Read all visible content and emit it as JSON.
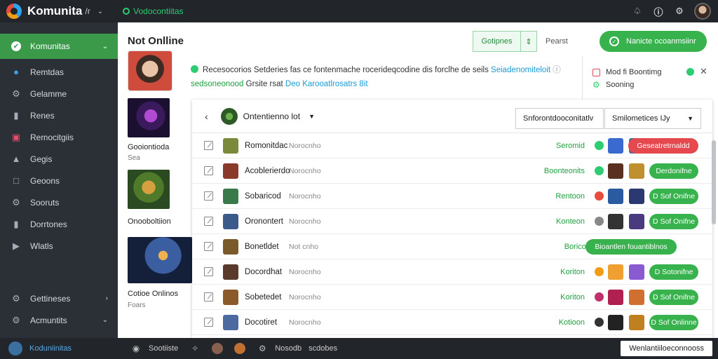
{
  "topbar": {
    "app_name": "Komunita",
    "app_sub": "/r",
    "status": "Vodocontiitas"
  },
  "sidebar": {
    "items": [
      {
        "label": "Komunitas",
        "icon": "check-icon"
      },
      {
        "label": "Remtdas",
        "icon": "people-icon"
      },
      {
        "label": "Gelamme",
        "icon": "gear-icon"
      },
      {
        "label": "Renes",
        "icon": "bookmark-icon"
      },
      {
        "label": "Remocitgiis",
        "icon": "chart-icon"
      },
      {
        "label": "Gegis",
        "icon": "lock-icon"
      },
      {
        "label": "Geoons",
        "icon": "document-icon"
      },
      {
        "label": "Sooruts",
        "icon": "gear-icon"
      },
      {
        "label": "Dorrtones",
        "icon": "briefcase-icon"
      },
      {
        "label": "Wlatls",
        "icon": "play-icon"
      }
    ],
    "bottom_items": [
      {
        "label": "Gettineses",
        "icon": "gear-icon"
      },
      {
        "label": "Acmuntits",
        "icon": "gear-icon"
      }
    ]
  },
  "main": {
    "page_title": "Not Onlline",
    "btn_secondary": "Gotipnes",
    "report_label": "Pearst",
    "btn_primary": "Nanicte ocoanmsiinr",
    "notice": {
      "line1_a": "Recesocorios Setderies fas ce fontenmache rocerideqcodine dis forclhe de seils",
      "line1_link": "Seiadenomiteloit",
      "line2_green": "sedsoneonood",
      "line2_b": "Grsite rsat",
      "line2_link": "Deo Karooatlrosatrs 8it"
    },
    "right_panel": {
      "row1": "Mod fi Boontimg",
      "row2": "Sooning"
    },
    "profile_thumbs": [
      {
        "caption": "Gooiontioda",
        "sub": "Sea"
      },
      {
        "caption": "Onooboltiion",
        "sub": ""
      },
      {
        "caption": "Cotioe Onlinos",
        "sub": "Foars"
      }
    ]
  },
  "table": {
    "title": "Ontentienno lot",
    "filter1": "Snforontdooconitatlv",
    "filter2": "Smilometices IJy",
    "rows": [
      {
        "name": "Romonitdac",
        "sub": "Norocnho",
        "status": "Seromid",
        "action": "Geseatretrnaldd",
        "action_type": "red"
      },
      {
        "name": "Acoblerierdo",
        "sub": "Norocnho",
        "status": "Boonteonits",
        "action": "Derdonifne",
        "action_type": "green"
      },
      {
        "name": "Sobaricod",
        "sub": "Norocnho",
        "status": "Rentoon",
        "action": "D Sof Onifne",
        "action_type": "green"
      },
      {
        "name": "Oronontert",
        "sub": "Norocnho",
        "status": "Konteon",
        "action": "D Sof Onifne",
        "action_type": "green"
      },
      {
        "name": "Bonetldet",
        "sub": "Not cnho",
        "status": "Boricon",
        "action": "Bioantlen fouantiblnos",
        "action_type": "wide"
      },
      {
        "name": "Docordhat",
        "sub": "Norocnho",
        "status": "Koriton",
        "action": "D Sotonifne",
        "action_type": "green"
      },
      {
        "name": "Sobetedet",
        "sub": "Norocnho",
        "status": "Koriton",
        "action": "D Sof Onifne",
        "action_type": "green"
      },
      {
        "name": "Docotiret",
        "sub": "Norocnho",
        "status": "Kotioon",
        "action": "D Sof Onlinne",
        "action_type": "green"
      }
    ]
  },
  "bottombar": {
    "left_label": "Koduniinitas",
    "items": [
      "Sootiiste",
      "Nosodb",
      "scdobes"
    ],
    "status": "Wenlantiiloeconnooss"
  },
  "colors": {
    "accent_green": "#37b24d",
    "danger_red": "#e5484d",
    "sidebar_bg": "#2b2f36",
    "topbar_bg": "#22252a",
    "link_blue": "#1b9ad6"
  }
}
